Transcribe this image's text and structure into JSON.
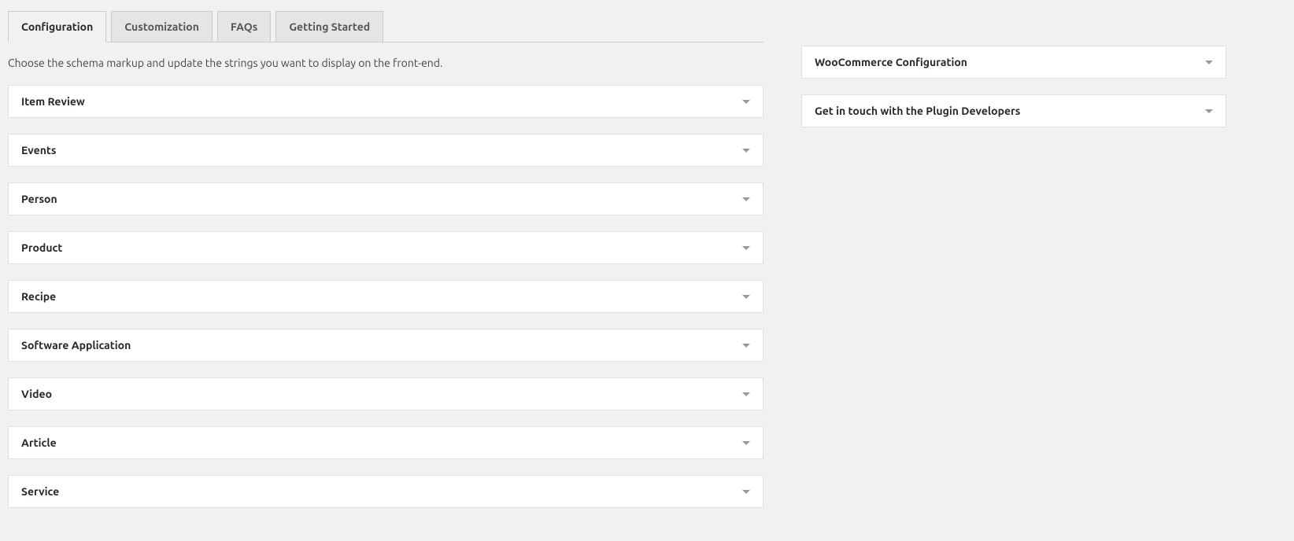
{
  "tabs": {
    "items": [
      {
        "label": "Configuration",
        "active": true
      },
      {
        "label": "Customization",
        "active": false
      },
      {
        "label": "FAQs",
        "active": false
      },
      {
        "label": "Getting Started",
        "active": false
      }
    ]
  },
  "intro": "Choose the schema markup and update the strings you want to display on the front-end.",
  "schemas": [
    {
      "label": "Item Review"
    },
    {
      "label": "Events"
    },
    {
      "label": "Person"
    },
    {
      "label": "Product"
    },
    {
      "label": "Recipe"
    },
    {
      "label": "Software Application"
    },
    {
      "label": "Video"
    },
    {
      "label": "Article"
    },
    {
      "label": "Service"
    }
  ],
  "sidebar": {
    "items": [
      {
        "label": "WooCommerce Configuration"
      },
      {
        "label": "Get in touch with the Plugin Developers"
      }
    ]
  }
}
